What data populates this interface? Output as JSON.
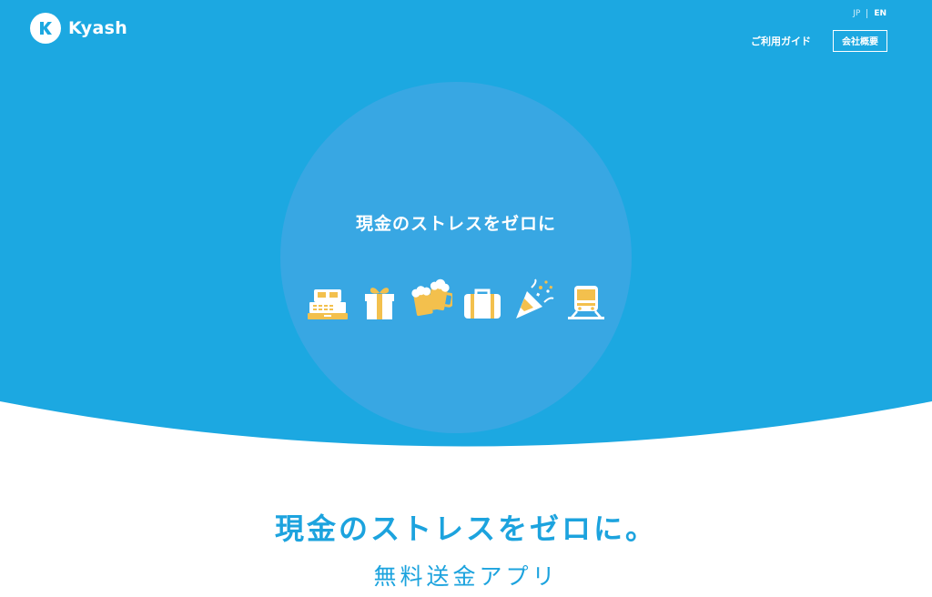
{
  "colors": {
    "brand_blue": "#1ca8e1",
    "circle_blue": "#38a7e3",
    "text_blue": "#1ca3de",
    "icon_yellow": "#f3c04d",
    "white": "#ffffff"
  },
  "header": {
    "logo_text": "Kyash",
    "logo_icon": "kyash-k-logo-icon",
    "lang_jp": "JP",
    "lang_en": "EN",
    "nav_guide": "ご利用ガイド",
    "nav_company": "会社概要"
  },
  "hero": {
    "circle_title": "現金のストレスをゼロに",
    "icons": [
      "cash-register-icon",
      "gift-box-icon",
      "beer-mugs-icon",
      "suitcase-icon",
      "party-popper-icon",
      "train-icon"
    ]
  },
  "main": {
    "tagline": "現金のストレスをゼロに。",
    "subtitle": "無料送金アプリ"
  }
}
